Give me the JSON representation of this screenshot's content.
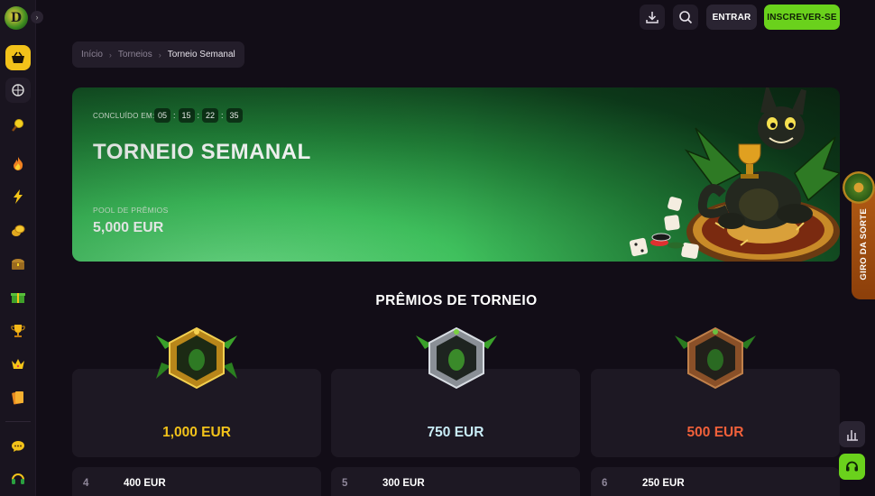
{
  "header": {
    "download_icon": "download-icon",
    "search_icon": "search-icon",
    "login_label": "ENTRAR",
    "signup_label": "INSCREVER-SE"
  },
  "sidebar": {
    "logo": "D",
    "items": [
      {
        "icon": "basket-icon",
        "active": true
      },
      {
        "icon": "sports-ball-icon",
        "active": false
      },
      {
        "icon": "magnifier-icon",
        "active": false
      },
      {
        "icon": "fire-icon",
        "active": false
      },
      {
        "icon": "lightning-icon",
        "active": false
      },
      {
        "icon": "coins-icon",
        "active": false
      },
      {
        "icon": "treasure-chest-icon",
        "active": false
      },
      {
        "icon": "gift-icon",
        "active": false
      },
      {
        "icon": "trophy-icon",
        "active": false
      },
      {
        "icon": "crown-icon",
        "active": false
      },
      {
        "icon": "cards-icon",
        "active": false
      },
      {
        "icon": "chat-icon",
        "active": false
      },
      {
        "icon": "headset-icon",
        "active": false
      }
    ]
  },
  "breadcrumb": {
    "home": "Início",
    "section": "Torneios",
    "current": "Torneio Semanal"
  },
  "hero": {
    "countdown_label": "CONCLUÍDO EM:",
    "countdown": [
      "05",
      "15",
      "22",
      "35"
    ],
    "title": "TORNEIO SEMANAL",
    "pool_label": "POOL DE PRÊMIOS",
    "pool_value": "5,000 EUR"
  },
  "side_tab": {
    "label": "GIRO DA SORTE"
  },
  "prizes": {
    "title": "PRÊMIOS DE TORNEIO",
    "top": [
      {
        "amount": "1,000 EUR",
        "color": "#f2c21a",
        "badge": "gold-dragon-badge"
      },
      {
        "amount": "750 EUR",
        "color": "#c9ecf6",
        "badge": "silver-dragon-badge"
      },
      {
        "amount": "500 EUR",
        "color": "#f0603a",
        "badge": "bronze-dragon-badge"
      }
    ],
    "ranks": [
      {
        "place": "4",
        "amount": "400 EUR"
      },
      {
        "place": "5",
        "amount": "300 EUR"
      },
      {
        "place": "6",
        "amount": "250 EUR"
      }
    ]
  },
  "colors": {
    "accent_green": "#6ad11c",
    "active_yellow": "#f2c21a",
    "background": "#120d17"
  }
}
